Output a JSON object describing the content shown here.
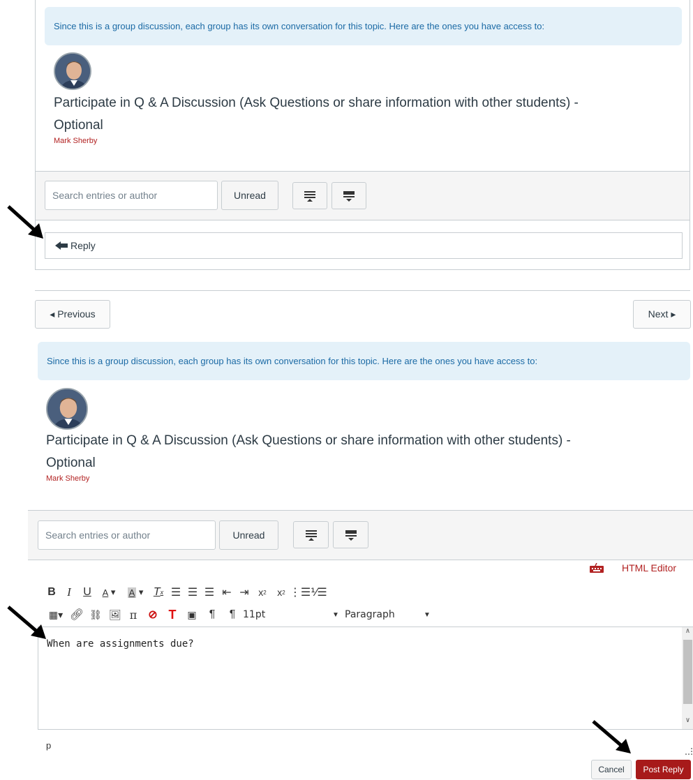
{
  "group_notice": "Since this is a group discussion, each group has its own conversation for this topic. Here are the ones you have access to:",
  "topic": {
    "title_line1": "Participate in Q & A Discussion (Ask Questions or share information with other students) -",
    "title_line2": "Optional",
    "author": "Mark Sherby"
  },
  "search": {
    "placeholder": "Search entries or author"
  },
  "filter": {
    "unread_label": "Unread"
  },
  "reply": {
    "label": "Reply"
  },
  "pagination": {
    "previous_label": "◂ Previous",
    "next_label": "Next ▸"
  },
  "editor": {
    "html_editor_label": "HTML Editor",
    "font_size": "11pt",
    "block_format": "Paragraph",
    "content": "When are assignments due?",
    "status_path": "p"
  },
  "actions": {
    "cancel_label": "Cancel",
    "post_label": "Post Reply"
  },
  "colors": {
    "accent": "#a71a1a",
    "info_bg": "#e4f1f9",
    "info_text": "#1b6aa5",
    "author": "#b22222"
  }
}
